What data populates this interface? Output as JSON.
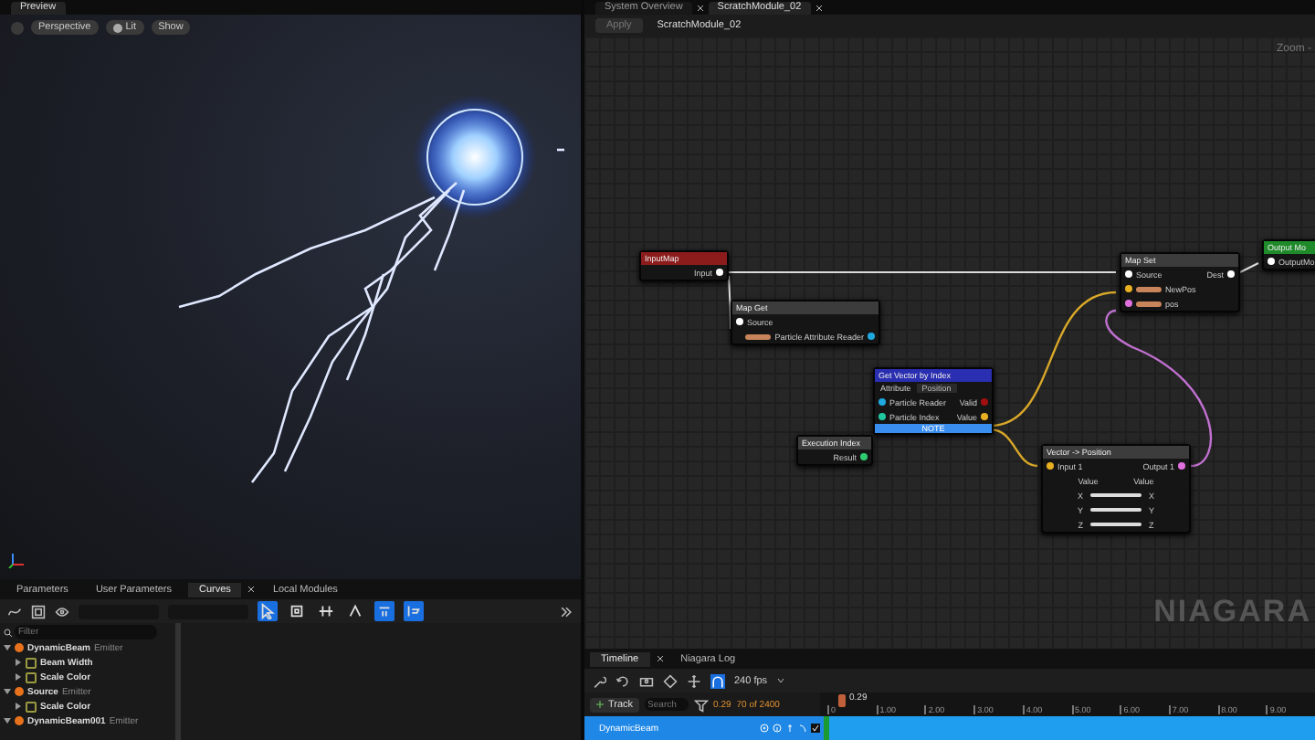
{
  "preview": {
    "tab": "Preview",
    "toolbar": [
      "Perspective",
      "Lit",
      "Show"
    ]
  },
  "editor_tabs": [
    {
      "label": "System Overview",
      "selected": false
    },
    {
      "label": "ScratchModule_02",
      "selected": true
    }
  ],
  "graph_toolbar": {
    "apply": "Apply",
    "apply_disabled": true,
    "title": "ScratchModule_02"
  },
  "graph": {
    "zoom": "Zoom -",
    "watermark": "NIAGARA",
    "nodes": [
      {
        "kind": "basic",
        "title": "InputMap",
        "color": "#8c1c1c",
        "rows": [
          {
            "right": {
              "label": "Input",
              "color": "#ffffff"
            }
          }
        ]
      },
      {
        "kind": "basic",
        "title": "Map Get",
        "color": "#3c3c3c",
        "rows": [
          {
            "left": {
              "label": "Source",
              "color": "#ffffff"
            }
          },
          {
            "right": {
              "label": "Particle Attribute Reader",
              "color": "#1fa8e0",
              "badge": true
            }
          }
        ]
      },
      {
        "kind": "basic",
        "title": "Get Vector by Index",
        "color": "#2a2eb0",
        "attribute": {
          "label": "Attribute",
          "value": "Position"
        },
        "rows": [
          {
            "left": {
              "label": "Particle Reader",
              "color": "#1fa8e0"
            },
            "right": {
              "label": "Valid",
              "color": "#a01010"
            }
          },
          {
            "left": {
              "label": "Particle Index",
              "color": "#20c8a0"
            },
            "right": {
              "label": "Value",
              "color": "#e8b020"
            }
          }
        ],
        "footer": "NOTE"
      },
      {
        "kind": "basic",
        "title": "Execution Index",
        "color": "#3c3c3c",
        "rows": [
          {
            "right": {
              "label": "Result",
              "color": "#2ecc71"
            }
          }
        ]
      },
      {
        "kind": "basic",
        "title": "Map Set",
        "color": "#3c3c3c",
        "rows": [
          {
            "left": {
              "label": "Source",
              "color": "#ffffff"
            },
            "right": {
              "label": "Dest",
              "color": "#ffffff"
            }
          },
          {
            "left": {
              "label": "NewPos",
              "color": "#e8b020",
              "badge": true
            }
          },
          {
            "left": {
              "label": "pos",
              "color": "#e070e0",
              "badge": true
            }
          }
        ]
      },
      {
        "kind": "basic",
        "title": "Output Mo",
        "color": "#1f8a2a",
        "rows": [
          {
            "left": {
              "label": "OutputMo",
              "color": "#ffffff"
            }
          }
        ]
      },
      {
        "kind": "vector",
        "title": "Vector -> Position",
        "color": "#3c3c3c",
        "rows": [
          {
            "left": {
              "label": "Input 1",
              "color": "#e8b020"
            },
            "right": {
              "label": "Output 1",
              "color": "#e070e0"
            }
          }
        ],
        "value_labels": [
          "Value",
          "Value"
        ],
        "axes": [
          {
            "left": "X",
            "right": "X",
            "level": 1
          },
          {
            "left": "Y",
            "right": "Y",
            "level": 1
          },
          {
            "left": "Z",
            "right": "Z",
            "level": 1
          }
        ]
      }
    ]
  },
  "bottom_tabs": [
    {
      "label": "Parameters",
      "selected": false
    },
    {
      "label": "User Parameters",
      "selected": false
    },
    {
      "label": "Curves",
      "selected": true
    },
    {
      "label": "Local Modules",
      "selected": false
    }
  ],
  "curve_tools": [
    {
      "on": true
    },
    {
      "on": false
    },
    {
      "on": false
    },
    {
      "on": false
    },
    {
      "on": true
    },
    {
      "on": true
    }
  ],
  "filter": {
    "placeholder": "Filter"
  },
  "tree": [
    {
      "label": "DynamicBeam",
      "tag": "Emitter",
      "expanded": true,
      "children": [
        {
          "label": "Beam Width",
          "expanded": false
        },
        {
          "label": "Scale Color",
          "expanded": false
        }
      ]
    },
    {
      "label": "Source",
      "tag": "Emitter",
      "expanded": true,
      "children": [
        {
          "label": "Scale Color",
          "expanded": false
        }
      ]
    },
    {
      "label": "DynamicBeam001",
      "tag": "Emitter",
      "expanded": true
    }
  ],
  "timeline": {
    "tabs": [
      {
        "label": "Timeline",
        "selected": true
      },
      {
        "label": "Niagara Log",
        "selected": false
      }
    ],
    "snap_on": true,
    "fps": "240 fps",
    "add_track": "Track",
    "search": {
      "placeholder": "Search"
    },
    "time": "0.29",
    "frame": "70 of 2400",
    "playhead": "0.29",
    "ruler": [
      "0",
      "1.00",
      "2.00",
      "3.00",
      "4.00",
      "5.00",
      "6.00",
      "7.00",
      "8.00",
      "9.00"
    ],
    "tracks": [
      {
        "name": "DynamicBeam",
        "selected": true,
        "enabled": true
      }
    ]
  }
}
